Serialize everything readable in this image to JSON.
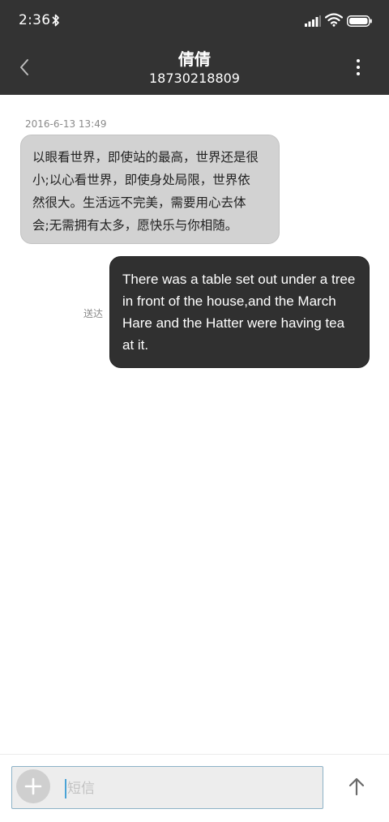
{
  "status_bar": {
    "time": "2:36",
    "icons": [
      "bluetooth-icon",
      "signal-icon",
      "wifi-icon",
      "battery-icon"
    ]
  },
  "header": {
    "contact_name": "倩倩",
    "phone_number": "18730218809",
    "back_icon": "chevron-left-icon",
    "menu_icon": "more-vertical-icon"
  },
  "conversation": {
    "timestamp": "2016-6-13 13:49",
    "incoming_message": {
      "lines": [
        "以眼看世界，即使站的最高，世界还是很",
        "小;以心看世界，即使身处局限，世界依",
        "然很大。生活远不完美，需要用心去体",
        "会;无需拥有太多，愿快乐与你相随。"
      ]
    },
    "outgoing_message": {
      "status": "送达",
      "lines": [
        "There was a table set out under a tree",
        "in front of the house,and the March",
        "Hare and the Hatter were having tea",
        "at it."
      ]
    }
  },
  "composer": {
    "placeholder": "短信",
    "attach_icon": "plus-icon",
    "send_icon": "arrow-up-icon"
  },
  "colors": {
    "header_bg": "#333333",
    "incoming_bubble": "#d2d2d2",
    "outgoing_bubble": "#303030",
    "input_border": "#8db2c7",
    "caret": "#4aa3d6"
  }
}
